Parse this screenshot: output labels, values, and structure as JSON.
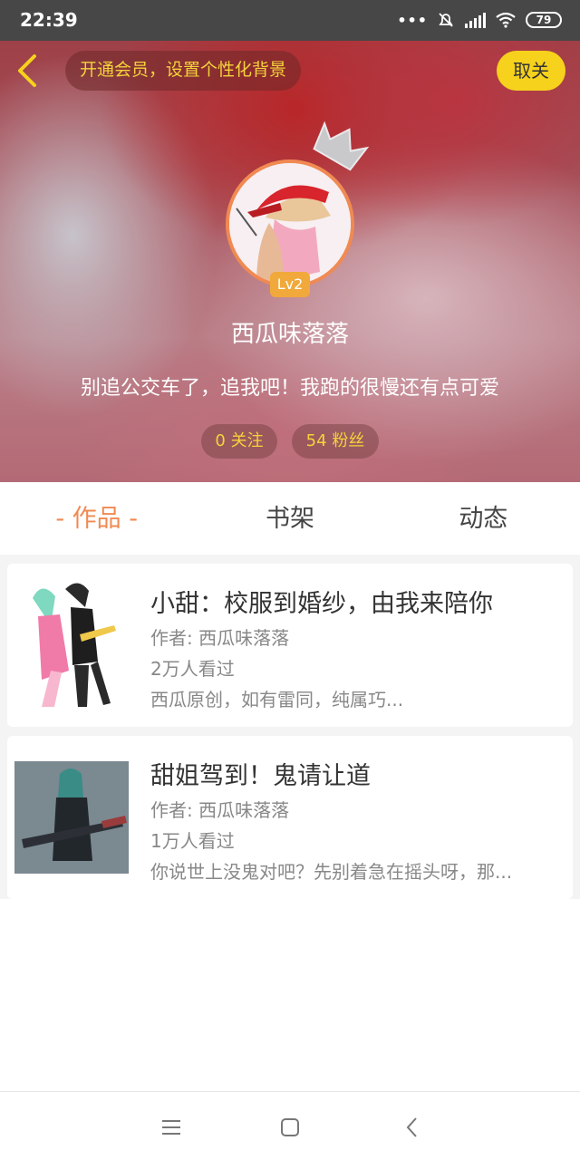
{
  "status_bar": {
    "time": "22:39",
    "dots": "•••",
    "battery": "79"
  },
  "header": {
    "vip_banner": "开通会员，设置个性化背景",
    "unfollow_label": "取关",
    "level": "Lv2",
    "username": "西瓜味落落",
    "bio": "别追公交车了，追我吧！我跑的很慢还有点可爱",
    "following_count": "0",
    "following_label": "关注",
    "fans_count": "54",
    "fans_label": "粉丝"
  },
  "tabs": [
    {
      "label": "- 作品 -",
      "active": true
    },
    {
      "label": "书架",
      "active": false
    },
    {
      "label": "动态",
      "active": false
    }
  ],
  "books": [
    {
      "title": "小甜：校服到婚纱，由我来陪你",
      "author": "作者: 西瓜味落落",
      "views": "2万人看过",
      "desc": "西瓜原创，如有雷同，纯属巧..."
    },
    {
      "title": "甜姐驾到！鬼请让道",
      "author": "作者: 西瓜味落落",
      "views": "1万人看过",
      "desc": "你说世上没鬼对吧？先别着急在摇头呀，那..."
    }
  ],
  "colors": {
    "accent": "#f08a52",
    "yellow": "#f6d21d",
    "gold_text": "#f4d33a"
  },
  "icons": [
    "back-arrow-icon",
    "crown-icon",
    "menu-icon",
    "home-square-icon",
    "back-chevron-icon",
    "mute-bell-icon",
    "signal-icon",
    "wifi-icon"
  ]
}
